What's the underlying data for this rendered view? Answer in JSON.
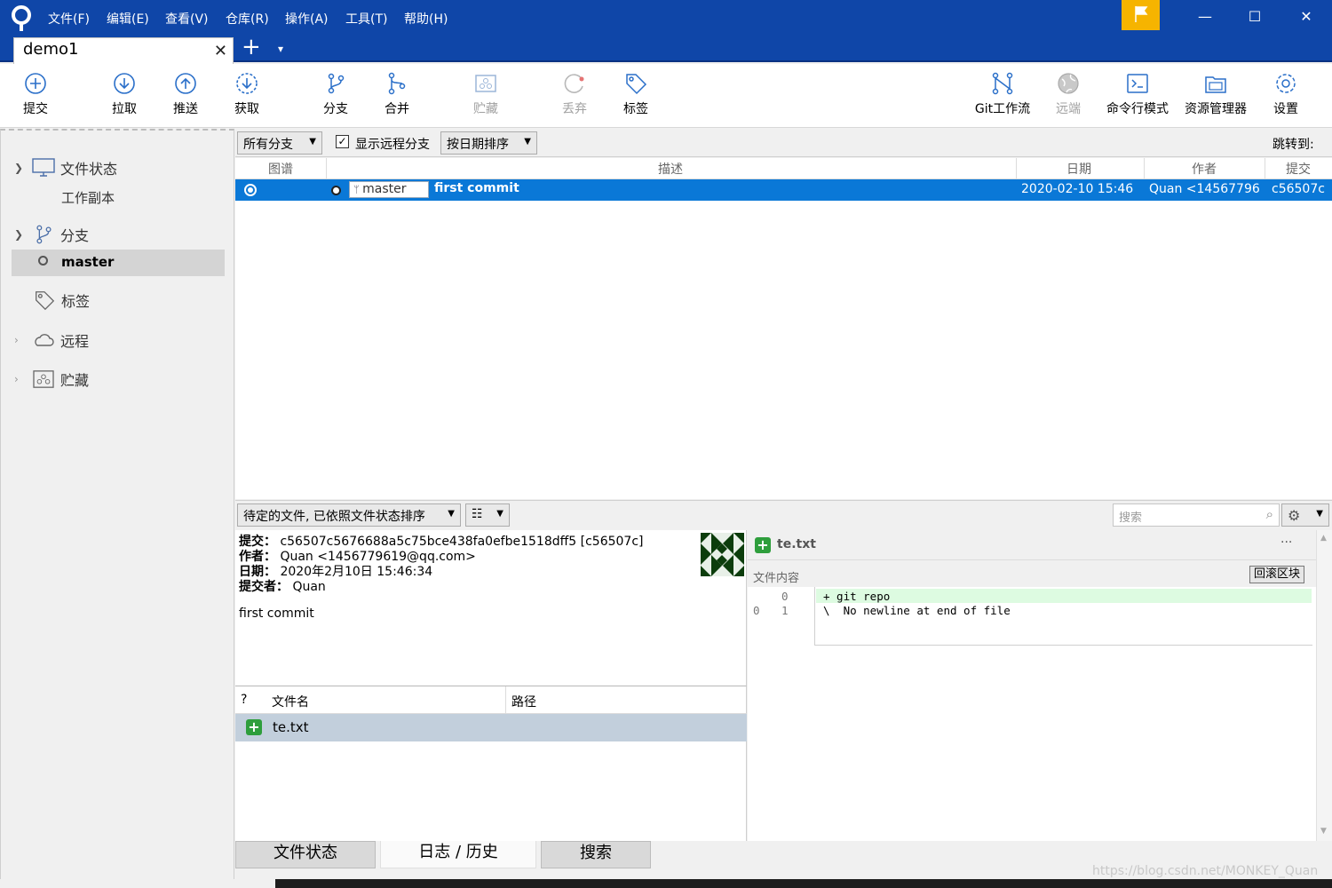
{
  "menu": [
    "文件(F)",
    "编辑(E)",
    "查看(V)",
    "仓库(R)",
    "操作(A)",
    "工具(T)",
    "帮助(H)"
  ],
  "tab": {
    "title": "demo1",
    "close": "✕",
    "new": "+",
    "more": "▾"
  },
  "toolbar": {
    "commit": "提交",
    "pull": "拉取",
    "push": "推送",
    "fetch": "获取",
    "branch": "分支",
    "merge": "合并",
    "stash": "贮藏",
    "discard": "丢弃",
    "tag": "标签",
    "gitflow": "Git工作流",
    "remote": "远端",
    "terminal": "命令行模式",
    "explorer": "资源管理器",
    "settings": "设置"
  },
  "sidebar": {
    "file_status": "文件状态",
    "working_copy": "工作副本",
    "branches": "分支",
    "master": "master",
    "tags": "标签",
    "remotes": "远程",
    "stashes": "贮藏"
  },
  "filter": {
    "branches": "所有分支",
    "show_remote": "显示远程分支",
    "sort": "按日期排序",
    "jump_to": "跳转到:"
  },
  "columns": {
    "graph": "图谱",
    "description": "描述",
    "date": "日期",
    "author": "作者",
    "commit": "提交"
  },
  "commit_row": {
    "branch_label": "master",
    "message": "first commit",
    "date": "2020-02-10 15:46",
    "author": "Quan <14567796",
    "hash": "c56507c"
  },
  "lower": {
    "pending_sort": "待定的文件, 已依照文件状态排序",
    "search_placeholder": "搜索"
  },
  "details": {
    "commit_label": "提交：",
    "commit_value": "c56507c5676688a5c75bce438fa0efbe1518dff5 [c56507c]",
    "author_label": "作者：",
    "author_value": "Quan <1456779619@qq.com>",
    "date_label": "日期：",
    "date_value": "2020年2月10日 15:46:34",
    "committer_label": "提交者：",
    "committer_value": "Quan",
    "message": "first commit"
  },
  "files": {
    "col_status": "?",
    "col_name": "文件名",
    "col_path": "路径",
    "rows": [
      {
        "name": "te.txt"
      }
    ]
  },
  "diff": {
    "filename": "te.txt",
    "more": "···",
    "content_label": "文件内容",
    "rollback": "回滚区块",
    "lines": [
      {
        "old": "",
        "new": "0",
        "text": "+ git repo"
      },
      {
        "old": "0",
        "new": "1",
        "text": "\\  No newline at end of file"
      }
    ]
  },
  "bottom_tabs": {
    "status": "文件状态",
    "log": "日志 / 历史",
    "search": "搜索"
  },
  "watermark": "https://blog.csdn.net/MONKEY_Quan"
}
